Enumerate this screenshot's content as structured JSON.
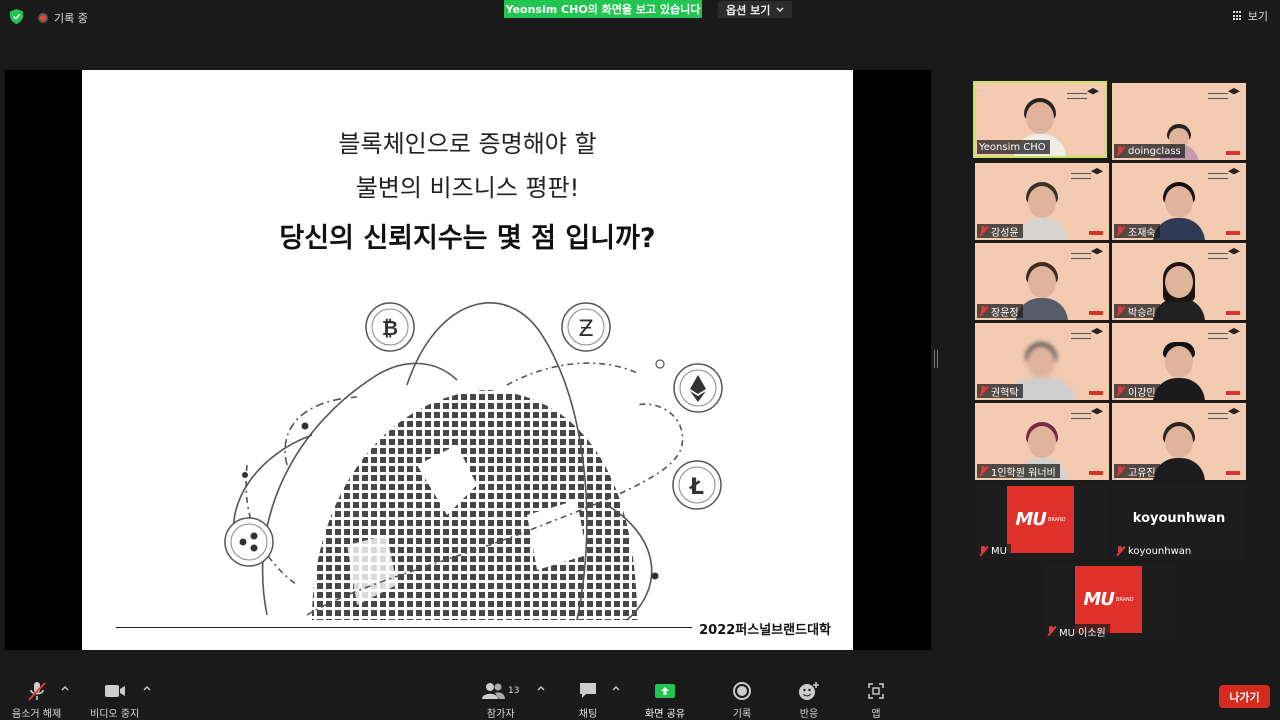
{
  "topbar": {
    "recording_label": "기록 중",
    "share_banner": "Yeonsim CHO의 화면을 보고 있습니다",
    "view_options_label": "옵션 보기",
    "view_label": "보기"
  },
  "slide": {
    "line1": "블록체인으로 증명해야 할",
    "line2": "불변의 비즈니스 평판!",
    "line3": "당신의 신뢰지수는 몇 점 입니까?",
    "footer": "2022퍼스널브랜드대학"
  },
  "participants": [
    {
      "name": "Yeonsim CHO"
    },
    {
      "name": "doingclass"
    },
    {
      "name": "강성윤"
    },
    {
      "name": "조재숙"
    },
    {
      "name": "장윤정"
    },
    {
      "name": "박승리"
    },
    {
      "name": "권혁탁"
    },
    {
      "name": "이강민"
    },
    {
      "name": "1인학원 워너비"
    },
    {
      "name": "고유진"
    },
    {
      "name": "MU"
    },
    {
      "name": "koyounhwan",
      "display": "koyounhwan"
    },
    {
      "name": "MU 이소원"
    }
  ],
  "logo_text": "MU",
  "logo_sub": "BRAND",
  "toolbar": {
    "mute_label": "음소거 해제",
    "video_label": "비디오 중지",
    "participants_label": "참가자",
    "participants_count": "13",
    "chat_label": "채팅",
    "share_label": "화면 공유",
    "record_label": "기록",
    "reactions_label": "반응",
    "apps_label": "앱",
    "leave_label": "나가기"
  },
  "colors": {
    "share_green": "#23c552",
    "leave_red": "#d52b1e",
    "active_speaker": "#c9e35a",
    "tile_bg": "#f2cbb1"
  }
}
